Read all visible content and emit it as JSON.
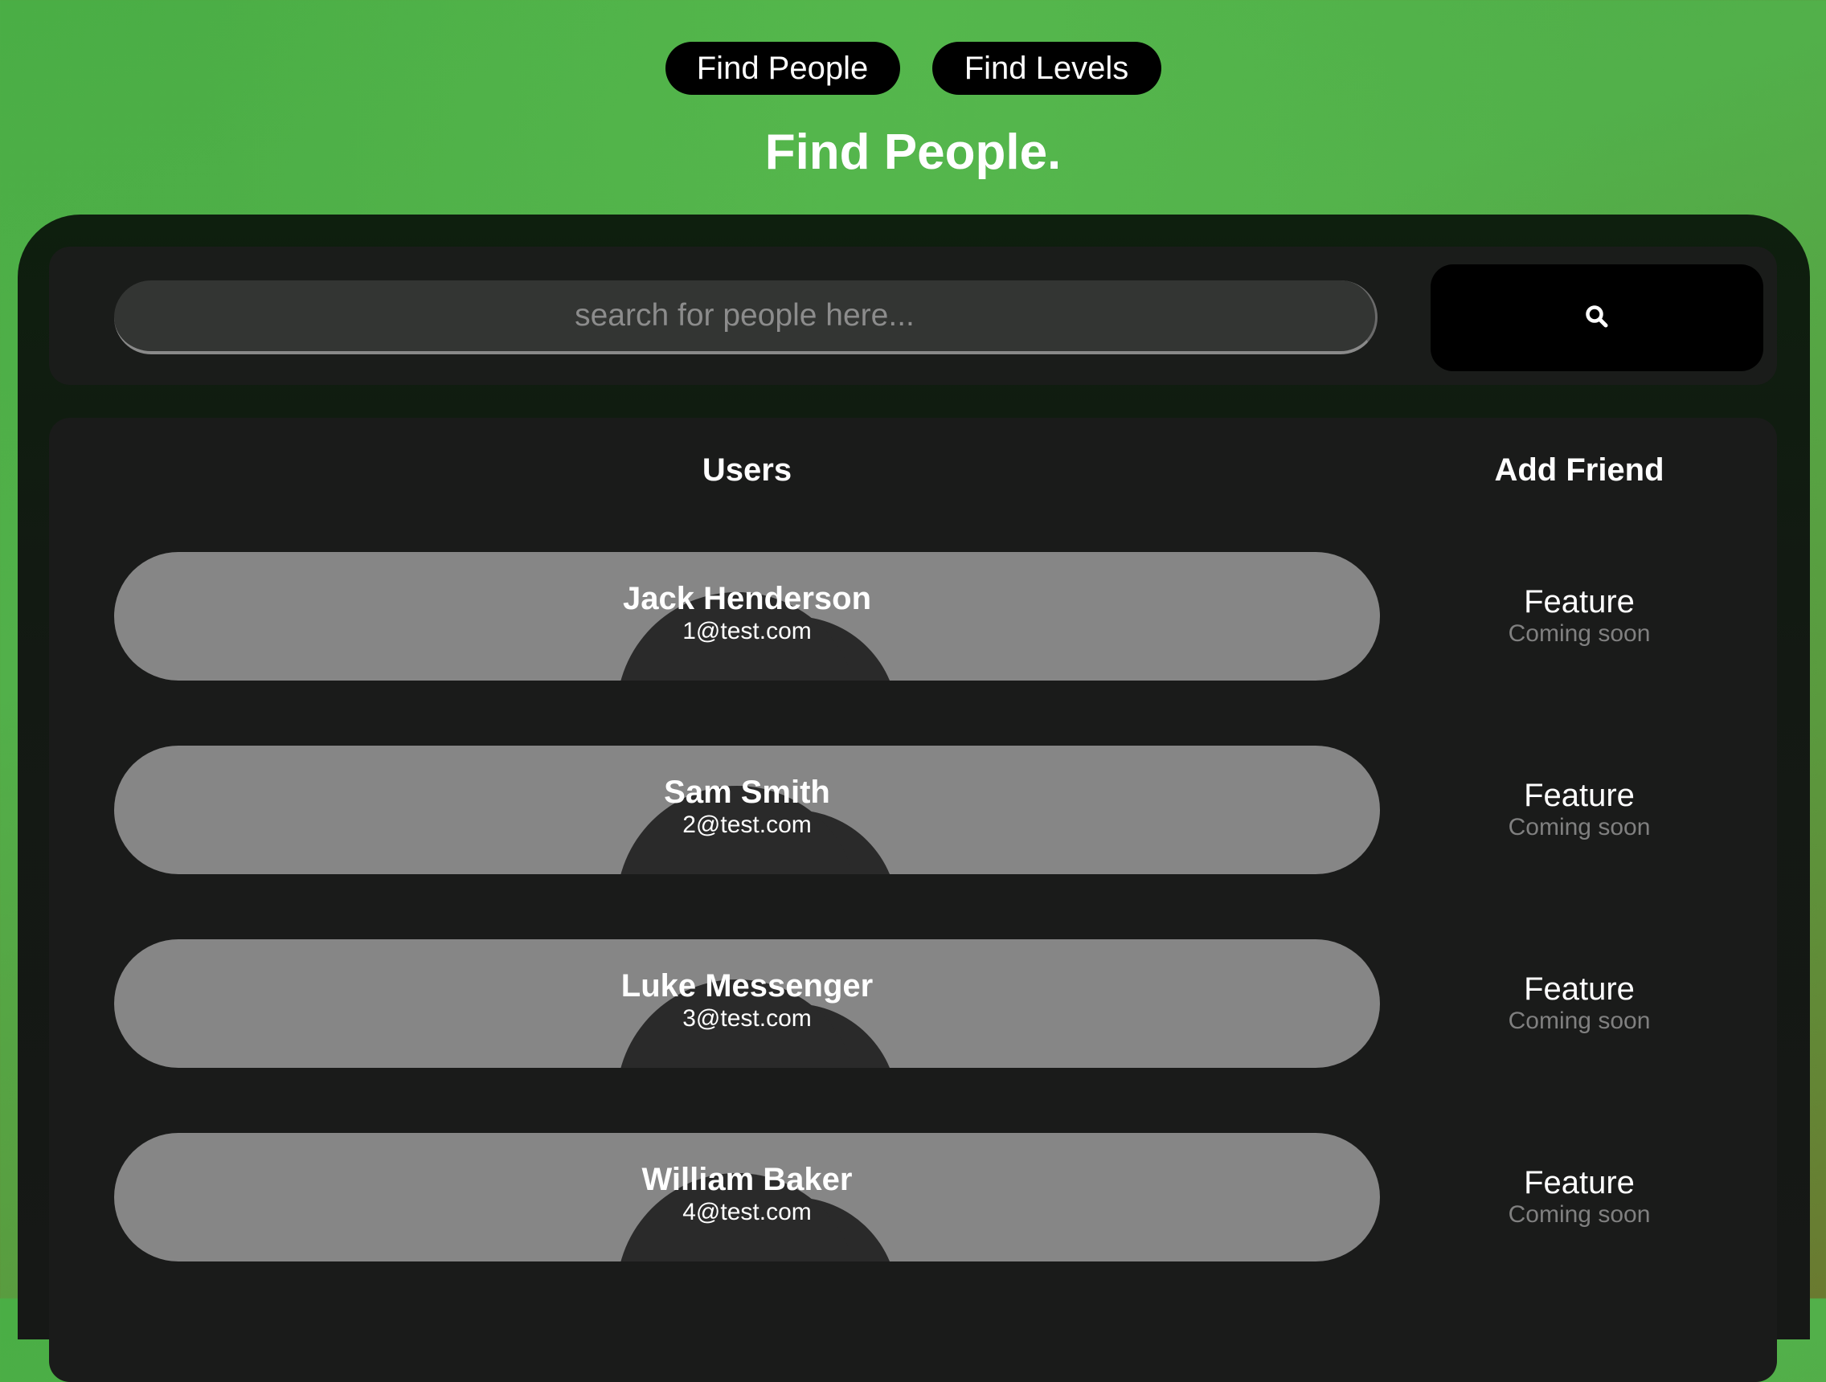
{
  "nav": {
    "items": [
      {
        "label": "Find People"
      },
      {
        "label": "Find Levels"
      }
    ]
  },
  "page": {
    "title": "Find People."
  },
  "search": {
    "placeholder": "search for people here...",
    "value": "",
    "button_icon": "search-icon"
  },
  "table": {
    "headers": {
      "users": "Users",
      "add_friend": "Add Friend"
    },
    "rows": [
      {
        "name": "Jack Henderson",
        "email": "1@test.com",
        "feature": "Feature",
        "status": "Coming soon"
      },
      {
        "name": "Sam Smith",
        "email": "2@test.com",
        "feature": "Feature",
        "status": "Coming soon"
      },
      {
        "name": "Luke Messenger",
        "email": "3@test.com",
        "feature": "Feature",
        "status": "Coming soon"
      },
      {
        "name": "William Baker",
        "email": "4@test.com",
        "feature": "Feature",
        "status": "Coming soon"
      }
    ]
  },
  "colors": {
    "background": "#4fae48",
    "panel": "#161816",
    "row": "#868686",
    "button": "#000000",
    "muted_text": "#808080"
  }
}
